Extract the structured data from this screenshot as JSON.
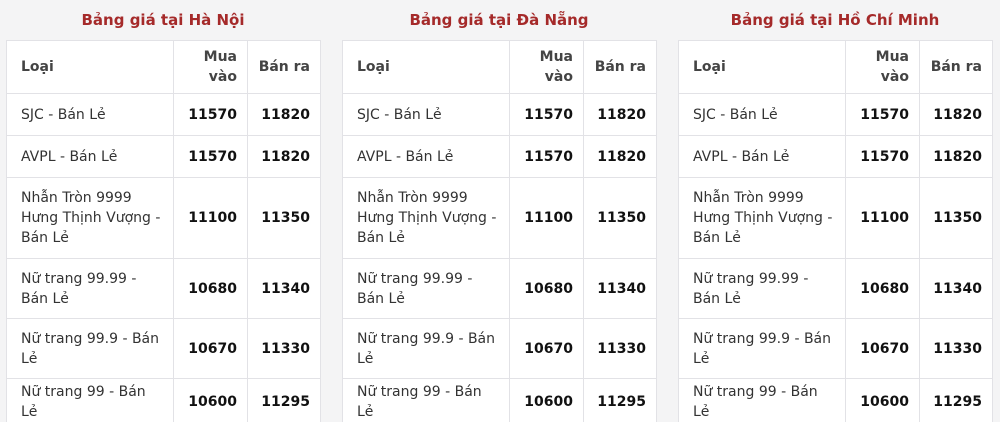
{
  "columns": {
    "type": "Loại",
    "buy": "Mua vào",
    "sell": "Bán ra"
  },
  "panels": [
    {
      "title": "Bảng giá tại Hà Nội",
      "rows": [
        {
          "name": "SJC - Bán Lẻ",
          "buy": "11570",
          "sell": "11820"
        },
        {
          "name": "AVPL - Bán Lẻ",
          "buy": "11570",
          "sell": "11820"
        },
        {
          "name": "Nhẫn Tròn 9999 Hưng Thịnh Vượng - Bán Lẻ",
          "buy": "11100",
          "sell": "11350"
        },
        {
          "name": "Nữ trang 99.99 - Bán Lẻ",
          "buy": "10680",
          "sell": "11340"
        },
        {
          "name": "Nữ trang 99.9 - Bán Lẻ",
          "buy": "10670",
          "sell": "11330"
        },
        {
          "name": "Nữ trang 99 - Bán Lẻ",
          "buy": "10600",
          "sell": "11295"
        }
      ]
    },
    {
      "title": "Bảng giá tại Đà Nẵng",
      "rows": [
        {
          "name": "SJC - Bán Lẻ",
          "buy": "11570",
          "sell": "11820"
        },
        {
          "name": "AVPL - Bán Lẻ",
          "buy": "11570",
          "sell": "11820"
        },
        {
          "name": "Nhẫn Tròn 9999 Hưng Thịnh Vượng - Bán Lẻ",
          "buy": "11100",
          "sell": "11350"
        },
        {
          "name": "Nữ trang 99.99 - Bán Lẻ",
          "buy": "10680",
          "sell": "11340"
        },
        {
          "name": "Nữ trang 99.9 - Bán Lẻ",
          "buy": "10670",
          "sell": "11330"
        },
        {
          "name": "Nữ trang 99 - Bán Lẻ",
          "buy": "10600",
          "sell": "11295"
        }
      ]
    },
    {
      "title": "Bảng giá tại Hồ Chí Minh",
      "rows": [
        {
          "name": "SJC - Bán Lẻ",
          "buy": "11570",
          "sell": "11820"
        },
        {
          "name": "AVPL - Bán Lẻ",
          "buy": "11570",
          "sell": "11820"
        },
        {
          "name": "Nhẫn Tròn 9999 Hưng Thịnh Vượng - Bán Lẻ",
          "buy": "11100",
          "sell": "11350"
        },
        {
          "name": "Nữ trang 99.99 - Bán Lẻ",
          "buy": "10680",
          "sell": "11340"
        },
        {
          "name": "Nữ trang 99.9 - Bán Lẻ",
          "buy": "10670",
          "sell": "11330"
        },
        {
          "name": "Nữ trang 99 - Bán Lẻ",
          "buy": "10600",
          "sell": "11295"
        }
      ]
    }
  ]
}
